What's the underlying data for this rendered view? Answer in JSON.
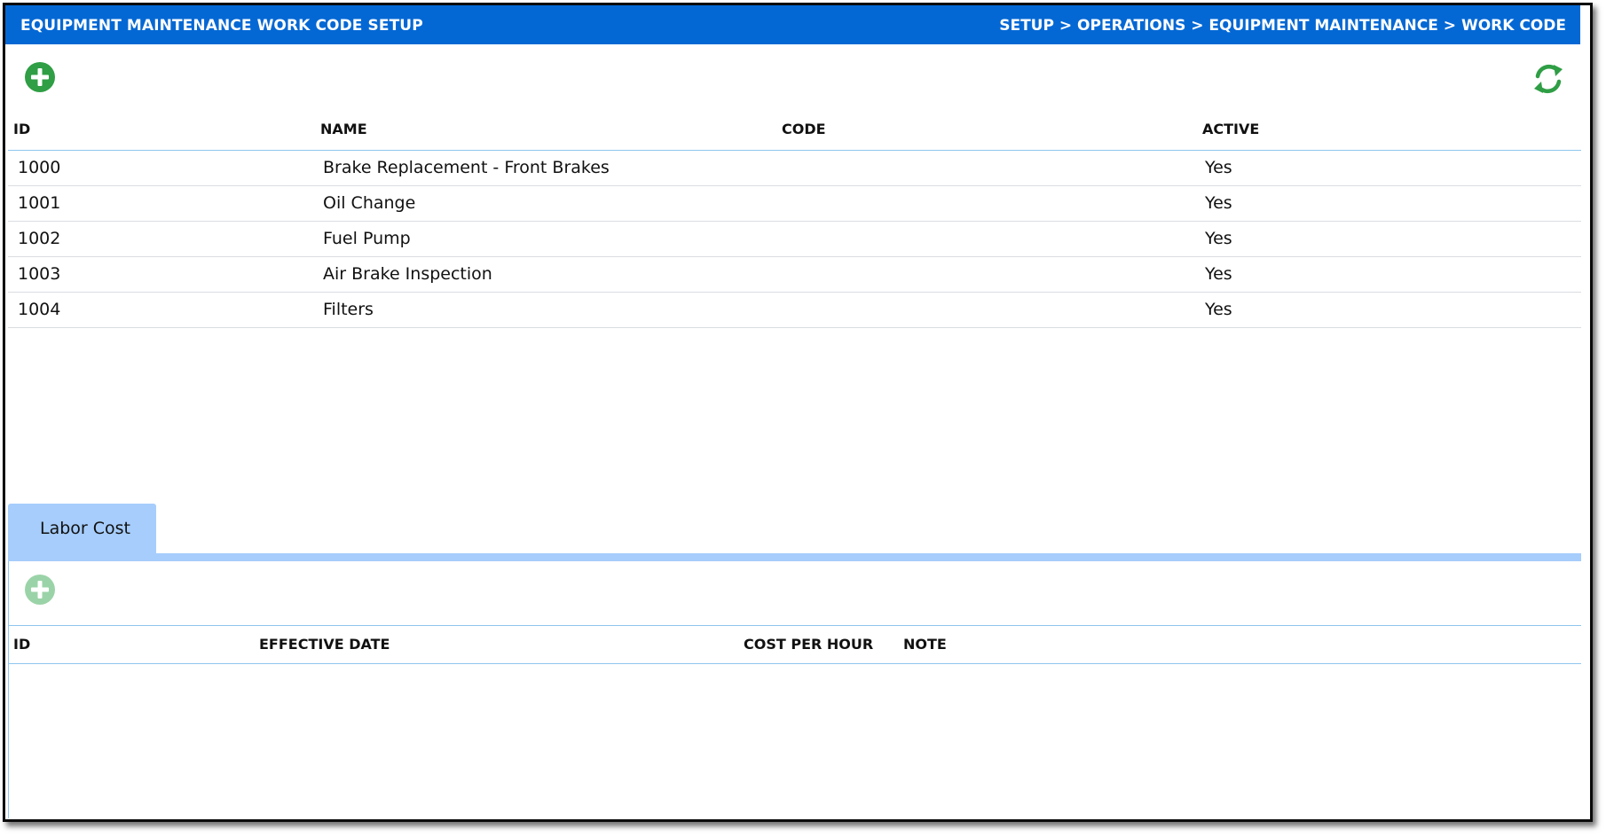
{
  "header": {
    "title": "EQUIPMENT MAINTENANCE WORK CODE SETUP",
    "breadcrumb": "SETUP > OPERATIONS > EQUIPMENT MAINTENANCE > WORK CODE"
  },
  "colors": {
    "header_bg": "#0468d4",
    "add_icon": "#2f9e45",
    "add_icon_disabled": "#9bd3a8",
    "refresh_icon": "#2f9e45",
    "tab_bg": "#a6cdfb",
    "grid_line": "#8fc6ee"
  },
  "icons": {
    "add": "plus-circle-icon",
    "refresh": "refresh-icon",
    "add_disabled": "plus-circle-icon"
  },
  "work_codes": {
    "columns": [
      "ID",
      "NAME",
      "CODE",
      "ACTIVE"
    ],
    "rows": [
      {
        "id": "1000",
        "name": "Brake Replacement - Front Brakes",
        "code": "",
        "active": "Yes"
      },
      {
        "id": "1001",
        "name": "Oil Change",
        "code": "",
        "active": "Yes"
      },
      {
        "id": "1002",
        "name": "Fuel Pump",
        "code": "",
        "active": "Yes"
      },
      {
        "id": "1003",
        "name": "Air Brake Inspection",
        "code": "",
        "active": "Yes"
      },
      {
        "id": "1004",
        "name": "Filters",
        "code": "",
        "active": "Yes"
      }
    ]
  },
  "tabs": [
    {
      "label": "Labor Cost",
      "active": true
    }
  ],
  "labor_cost": {
    "columns": [
      "ID",
      "EFFECTIVE DATE",
      "COST PER HOUR",
      "NOTE"
    ],
    "rows": []
  }
}
